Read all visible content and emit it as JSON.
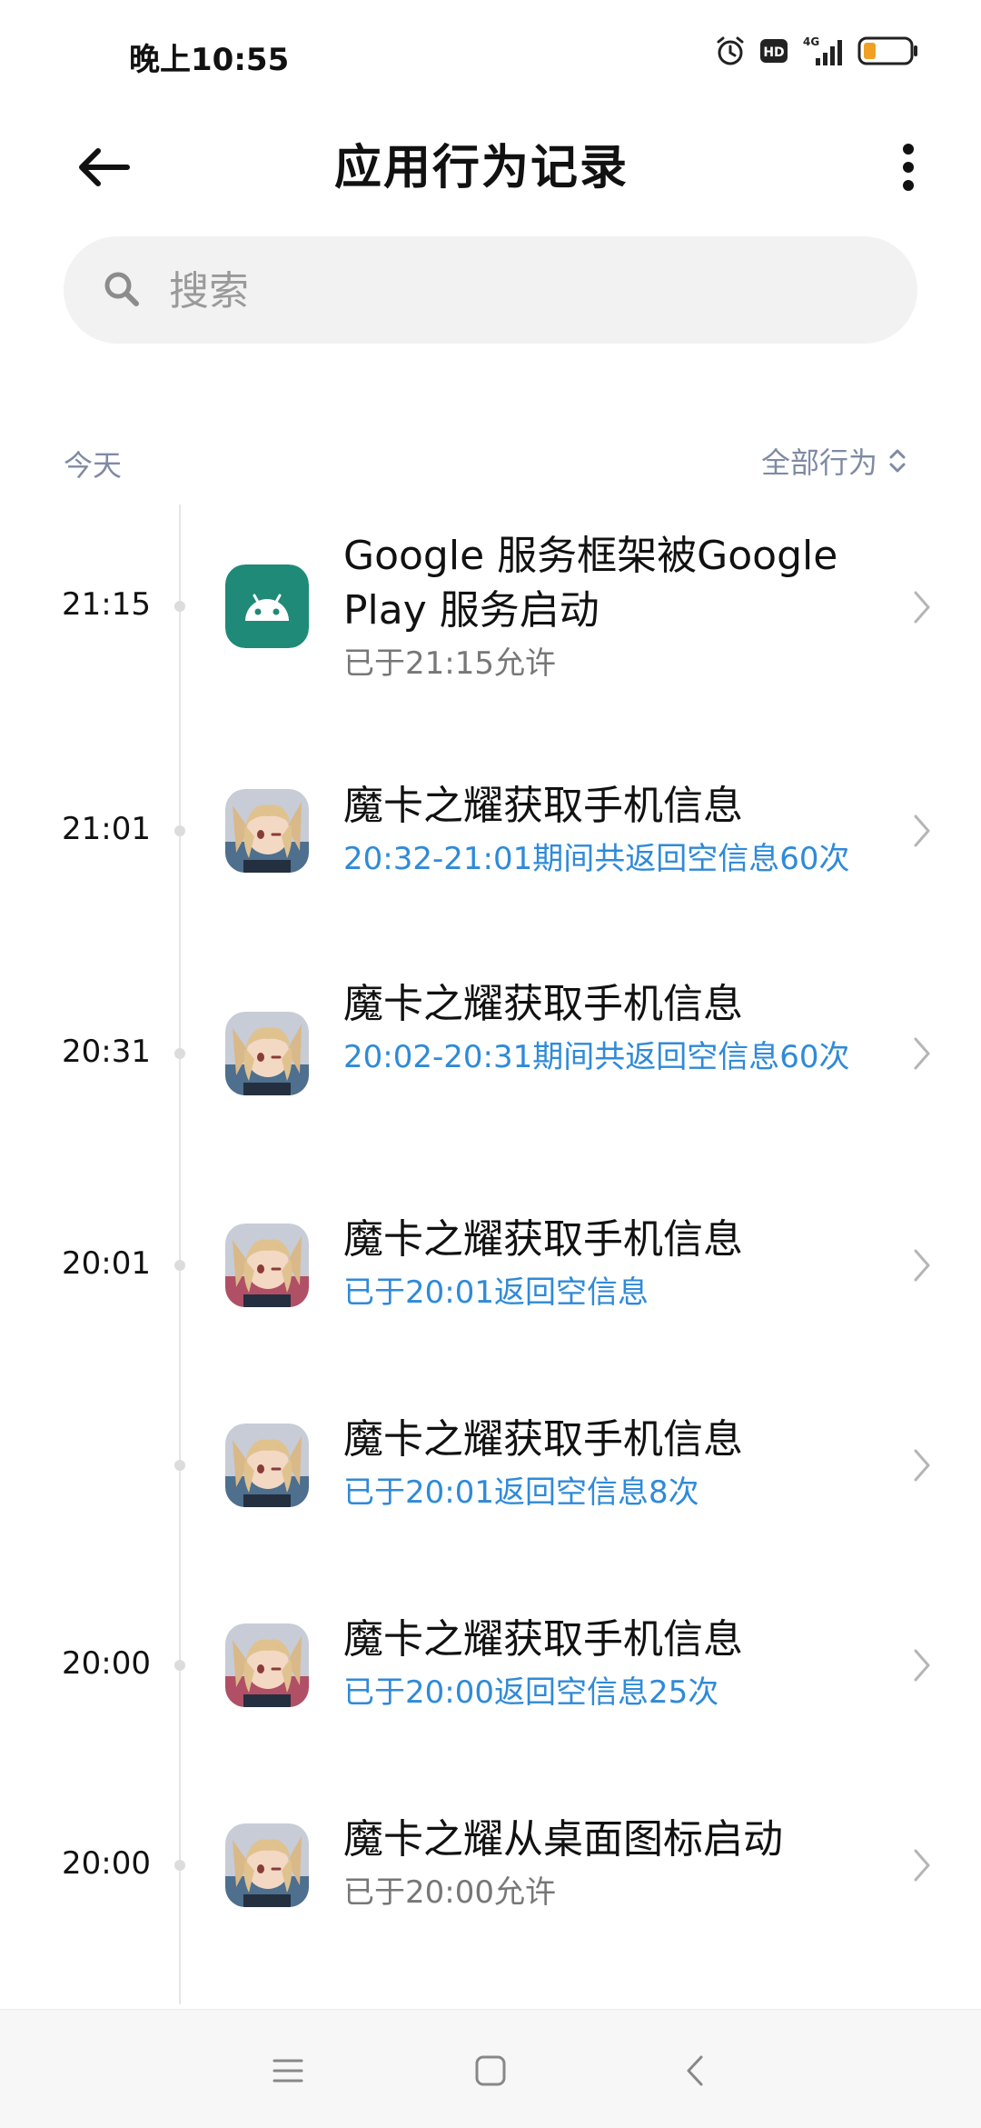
{
  "status_bar": {
    "time": "晚上10:55",
    "icons": [
      "alarm-icon",
      "hd-icon",
      "signal-4g-icon",
      "battery-low-icon"
    ],
    "network_label": "4G"
  },
  "header": {
    "title": "应用行为记录"
  },
  "search": {
    "placeholder": "搜索"
  },
  "list": {
    "day_label": "今天",
    "filter_label": "全部行为"
  },
  "entries": [
    {
      "time": "21:15",
      "icon": "android-icon",
      "title": "Google 服务框架被Google Play 服务启动",
      "subtitle": "已于21:15允许",
      "subtitle_style": "gray"
    },
    {
      "time": "21:01",
      "icon": "anime-app-icon",
      "title": "魔卡之耀获取手机信息",
      "subtitle": "20:32-21:01期间共返回空信息60次",
      "subtitle_style": "blue"
    },
    {
      "time": "20:31",
      "icon": "anime-app-icon",
      "title": "魔卡之耀获取手机信息",
      "subtitle": "20:02-20:31期间共返回空信息60次",
      "subtitle_style": "blue"
    },
    {
      "time": "20:01",
      "icon": "anime-app-icon",
      "title": "魔卡之耀获取手机信息",
      "subtitle": "已于20:01返回空信息",
      "subtitle_style": "blue"
    },
    {
      "time": "",
      "icon": "anime-app-icon",
      "title": "魔卡之耀获取手机信息",
      "subtitle": "已于20:01返回空信息8次",
      "subtitle_style": "blue"
    },
    {
      "time": "20:00",
      "icon": "anime-app-icon",
      "title": "魔卡之耀获取手机信息",
      "subtitle": "已于20:00返回空信息25次",
      "subtitle_style": "blue"
    },
    {
      "time": "20:00",
      "icon": "anime-app-icon",
      "title": "魔卡之耀从桌面图标启动",
      "subtitle": "已于20:00允许",
      "subtitle_style": "gray"
    }
  ],
  "colors": {
    "accent_blue": "#2f8ad8",
    "android_green": "#1e8a77",
    "muted_label": "#7f8aa3"
  },
  "nav": {
    "icons": [
      "menu-icon",
      "home-icon",
      "back-icon"
    ]
  }
}
